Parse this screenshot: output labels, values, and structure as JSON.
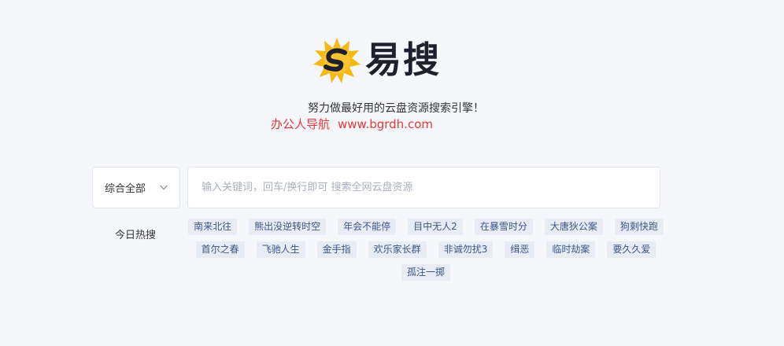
{
  "brand": {
    "name": "易搜",
    "slogan": "努力做最好用的云盘资源搜索引擎！",
    "promo_name": "办公人导航",
    "promo_url": "www.bgrdh.com",
    "logo_colors": {
      "sun": "#f5b914",
      "letter": "#1f1f2e"
    }
  },
  "search": {
    "type_selected": "综合全部",
    "placeholder": "输入关键词，回车/换行即可 搜索全网云盘资源",
    "value": ""
  },
  "hot": {
    "label": "今日热搜",
    "tags": [
      "南来北往",
      "熊出没逆转时空",
      "年会不能停",
      "目中无人2",
      "在暴雪时分",
      "大唐狄公案",
      "狗剩快跑",
      "首尔之春",
      "飞驰人生",
      "金手指",
      "欢乐家长群",
      "非诚勿扰3",
      "缉恶",
      "临时劫案",
      "要久久爱",
      "孤注一掷"
    ]
  },
  "icons": {
    "logo": "sun-s-logo-icon",
    "dropdown": "chevron-down-icon"
  }
}
